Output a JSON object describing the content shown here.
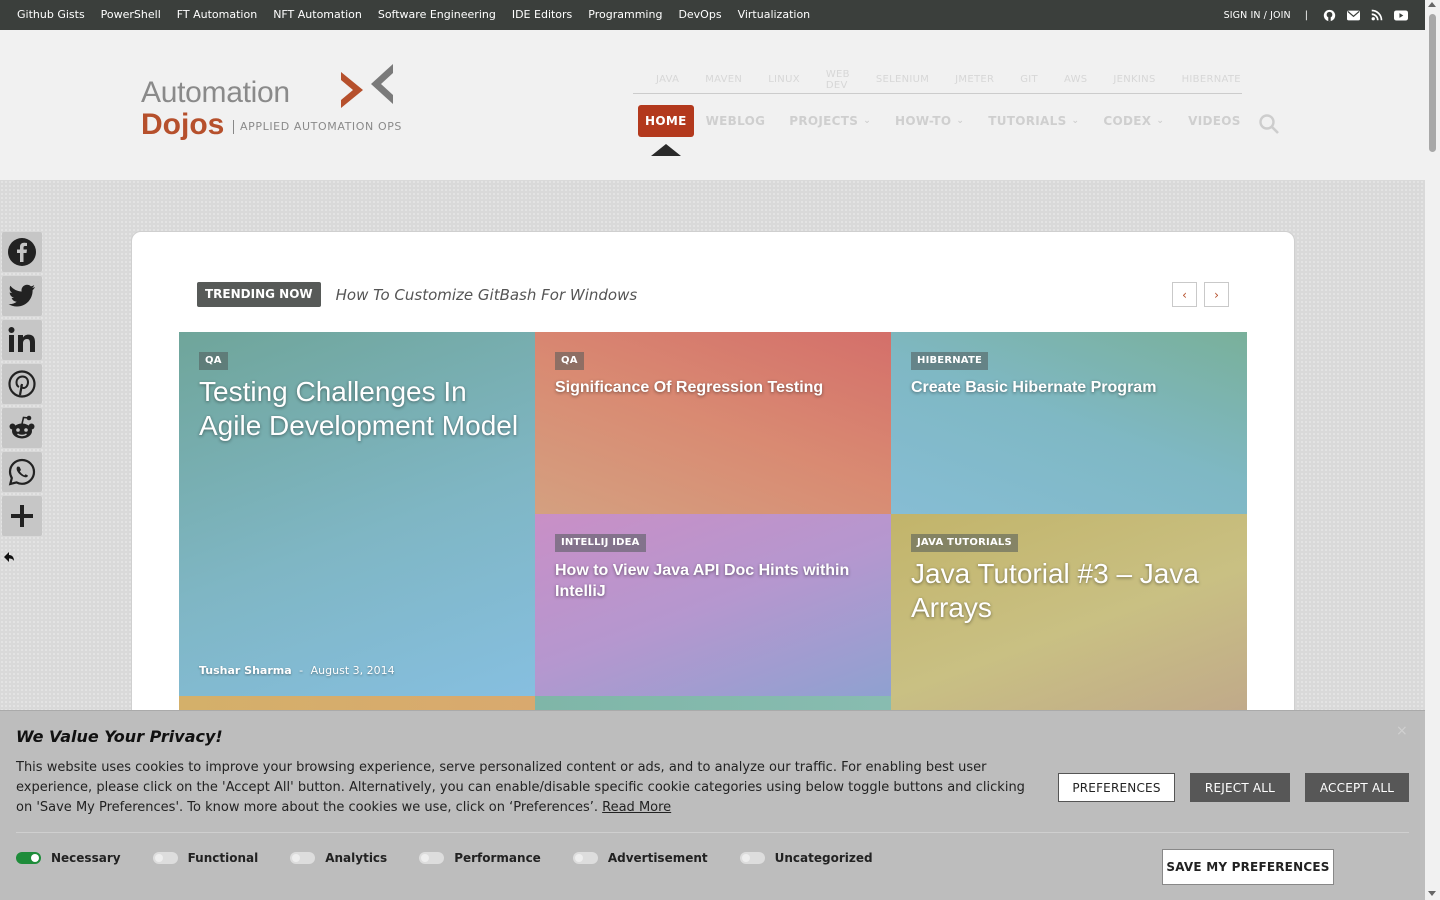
{
  "topbar": {
    "links": [
      "Github Gists",
      "PowerShell",
      "FT Automation",
      "NFT Automation",
      "Software Engineering",
      "IDE Editors",
      "Programming",
      "DevOps",
      "Virtualization"
    ],
    "sign_in": "SIGN IN / JOIN",
    "separator": "|",
    "icons": [
      "github-icon",
      "mail-icon",
      "rss-icon",
      "youtube-icon"
    ]
  },
  "logo": {
    "line1": "Automation",
    "line2": "Dojos",
    "tagline": "APPLIED AUTOMATION OPS"
  },
  "subnav": [
    "JAVA",
    "MAVEN",
    "LINUX",
    "WEB DEV",
    "SELENIUM",
    "JMETER",
    "GIT",
    "AWS",
    "JENKINS",
    "HIBERNATE"
  ],
  "mainnav": {
    "items": [
      {
        "label": "HOME",
        "active": true,
        "dropdown": false
      },
      {
        "label": "WEBLOG",
        "active": false,
        "dropdown": false
      },
      {
        "label": "PROJECTS",
        "active": false,
        "dropdown": true
      },
      {
        "label": "HOW-TO",
        "active": false,
        "dropdown": true
      },
      {
        "label": "TUTORIALS",
        "active": false,
        "dropdown": true
      },
      {
        "label": "CODEX",
        "active": false,
        "dropdown": true
      },
      {
        "label": "VIDEOS",
        "active": false,
        "dropdown": false
      }
    ],
    "chevron": "⌄"
  },
  "share": [
    "facebook-icon",
    "twitter-icon",
    "linkedin-icon",
    "pinterest-icon",
    "reddit-icon",
    "whatsapp-icon",
    "plus-icon"
  ],
  "trending": {
    "badge": "TRENDING NOW",
    "title": "How To Customize GitBash For Windows",
    "prev": "‹",
    "next": "›"
  },
  "tiles": [
    {
      "category": "QA",
      "title": "Testing Challenges In Agile Development Model",
      "author": "Tushar Sharma",
      "sep": "-",
      "date": "August 3, 2014"
    },
    {
      "category": "QA",
      "title": "Significance Of Regression Testing"
    },
    {
      "category": "HIBERNATE",
      "title": "Create Basic Hibernate Program"
    },
    {
      "category": "INTELLIJ IDEA",
      "title": "How to View Java API Doc Hints within IntelliJ"
    },
    {
      "category": "JAVA TUTORIALS",
      "title": "Java Tutorial #3 – Java Arrays"
    }
  ],
  "cookie": {
    "title": "We Value Your Privacy!",
    "text": "This website uses cookies to improve your browsing experience, serve personalized content or ads, and to analyze our traffic. For enabling best user experience, please click on the 'Accept All' button. Alternatively, you can enable/disable specific cookie categories using below toggle buttons and clicking on 'Save My Preferences'. To know more about the cookies we use, click on ‘Preferences’.",
    "read_more": "Read More",
    "preferences": "PREFERENCES",
    "reject_all": "REJECT ALL",
    "accept_all": "ACCEPT ALL",
    "save": "SAVE MY PREFERENCES",
    "toggles": [
      {
        "label": "Necessary",
        "on": true
      },
      {
        "label": "Functional",
        "on": false
      },
      {
        "label": "Analytics",
        "on": false
      },
      {
        "label": "Performance",
        "on": false
      },
      {
        "label": "Advertisement",
        "on": false
      },
      {
        "label": "Uncategorized",
        "on": false
      }
    ],
    "close": "×"
  },
  "colors": {
    "accent": "#b3391d",
    "topbar": "#3b3f3c",
    "toggle_on": "#1e8c3a"
  }
}
